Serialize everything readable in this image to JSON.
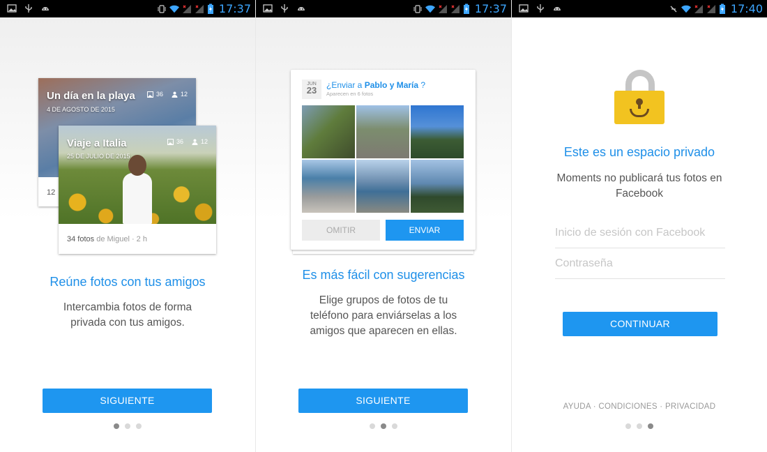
{
  "status": {
    "time_1": "17:37",
    "time_2": "17:37",
    "time_3": "17:40",
    "left_icons": [
      "image-icon",
      "usb-icon",
      "android-icon"
    ],
    "right_icons": [
      "vibrate-icon",
      "wifi-icon",
      "signal-icon",
      "signal-icon",
      "battery-icon"
    ],
    "accent": "#3da6ff"
  },
  "screen1": {
    "card_back": {
      "title": "Un día en la playa",
      "date": "4 DE AGOSTO DE 2015",
      "photos": "36",
      "people": "12",
      "footer_count": "12"
    },
    "card_front": {
      "title": "Viaje a Italia",
      "date": "25 DE JULIO DE 2015",
      "photos": "36",
      "people": "12",
      "footer_bold": "34 fotos",
      "footer_rest": " de Miguel · 2 h"
    },
    "title": "Reúne fotos con tus amigos",
    "description": "Intercambia fotos de forma privada con tus amigos.",
    "button": "SIGUIENTE"
  },
  "screen2": {
    "date_month": "JUN",
    "date_day": "23",
    "question_prefix": "¿Enviar a ",
    "question_names": "Pablo y María",
    "question_suffix": " ?",
    "subtitle": "Aparecen en 6 fotos",
    "omit": "OMITIR",
    "send": "ENVIAR",
    "title": "Es más fácil con sugerencias",
    "description": "Elige grupos de fotos de tu teléfono para enviárselas a los amigos que aparecen en ellas.",
    "button": "SIGUIENTE"
  },
  "screen3": {
    "title": "Este es un espacio privado",
    "description": "Moments no publicará tus fotos en Facebook",
    "login_placeholder": "Inicio de sesión con Facebook",
    "password_placeholder": "Contraseña",
    "button": "CONTINUAR",
    "link_help": "AYUDA",
    "link_terms": "CONDICIONES",
    "link_privacy": "PRIVACIDAD",
    "separator": " · "
  },
  "colors": {
    "brand_blue": "#1e96f0",
    "title_blue": "#1e8fe8",
    "lock_yellow": "#f2c320"
  },
  "pager": {
    "screen1_active": 1,
    "screen2_active": 2,
    "screen3_active": 3,
    "total": 3
  }
}
